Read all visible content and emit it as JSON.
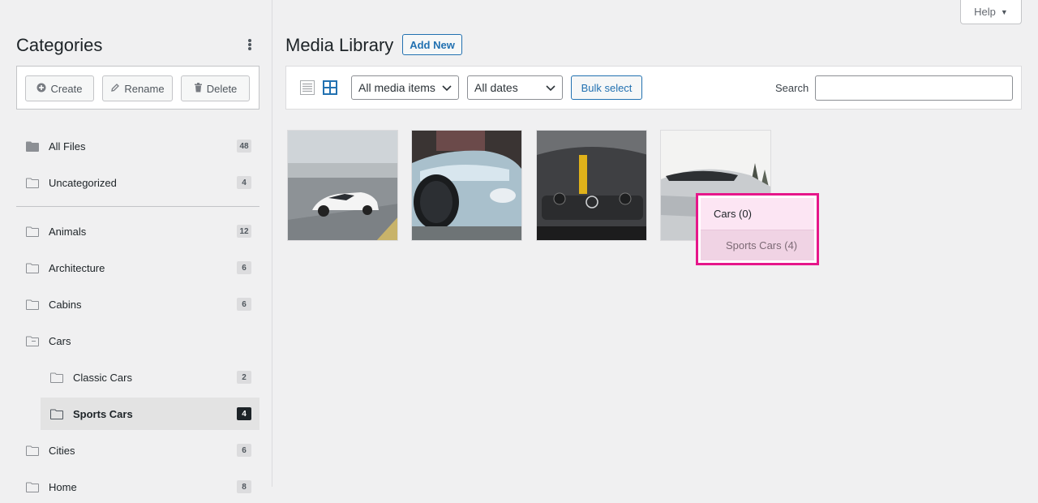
{
  "help": {
    "label": "Help",
    "caret": "▼"
  },
  "sidebar": {
    "title": "Categories",
    "actions": {
      "create": "Create",
      "rename": "Rename",
      "delete": "Delete"
    },
    "folders": [
      {
        "label": "All Files",
        "count": "48"
      },
      {
        "label": "Uncategorized",
        "count": "4"
      },
      {
        "label": "Animals",
        "count": "12"
      },
      {
        "label": "Architecture",
        "count": "6"
      },
      {
        "label": "Cabins",
        "count": "6"
      },
      {
        "label": "Cars",
        "count": ""
      },
      {
        "label": "Classic Cars",
        "count": "2"
      },
      {
        "label": "Sports Cars",
        "count": "4"
      },
      {
        "label": "Cities",
        "count": "6"
      },
      {
        "label": "Home",
        "count": "8"
      }
    ],
    "active_folder": "Sports Cars"
  },
  "main": {
    "title": "Media Library",
    "add_new": "Add New",
    "toolbar": {
      "media_filter": "All media items",
      "date_filter": "All dates",
      "bulk_select": "Bulk select",
      "search_label": "Search",
      "search_value": ""
    },
    "thumbnails": [
      {
        "alt": "white sports car on road"
      },
      {
        "alt": "silver supercar front"
      },
      {
        "alt": "dark Mercedes with yellow stripe"
      },
      {
        "alt": "white sports car near trees"
      }
    ]
  },
  "drag_popup": {
    "target": "Cars (0)",
    "source": "Sports Cars (4)",
    "border_color": "#e6178a"
  },
  "colors": {
    "accent": "#2271b1",
    "popup_accent": "#e6178a"
  }
}
